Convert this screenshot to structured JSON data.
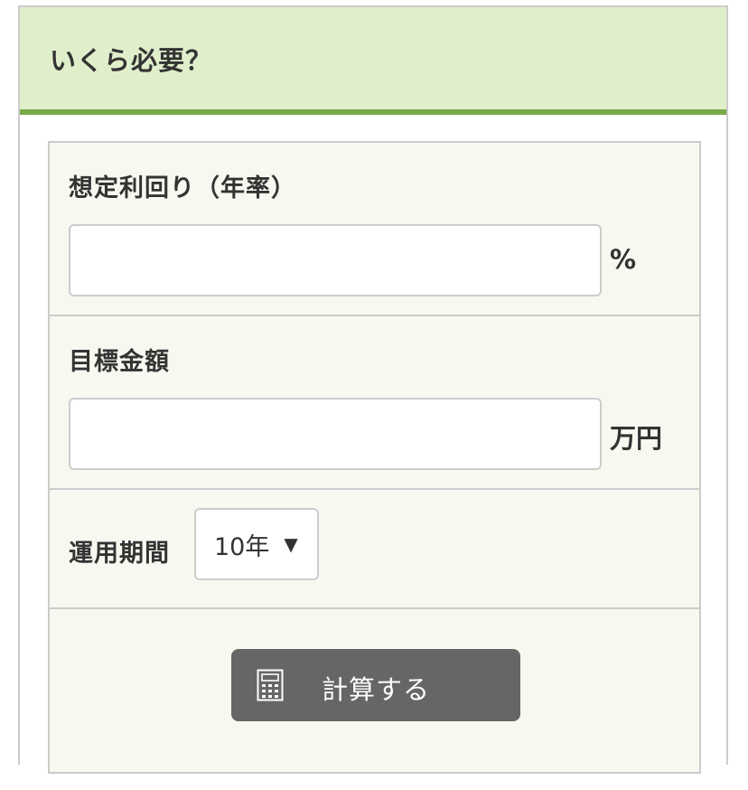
{
  "header": {
    "title": "いくら必要？"
  },
  "form": {
    "rate": {
      "label": "想定利回り（年率）",
      "value": "",
      "unit": "%"
    },
    "target": {
      "label": "目標金額",
      "value": "",
      "unit": "万円"
    },
    "period": {
      "label": "運用期間",
      "selected": "10年",
      "arrow": "▼"
    },
    "action": {
      "button_label": "計算する",
      "icon": "calculator-icon"
    }
  },
  "colors": {
    "header_bg": "#e0efcb",
    "header_accent": "#77a949",
    "form_bg": "#f6f9ef",
    "button_bg": "#666666"
  }
}
